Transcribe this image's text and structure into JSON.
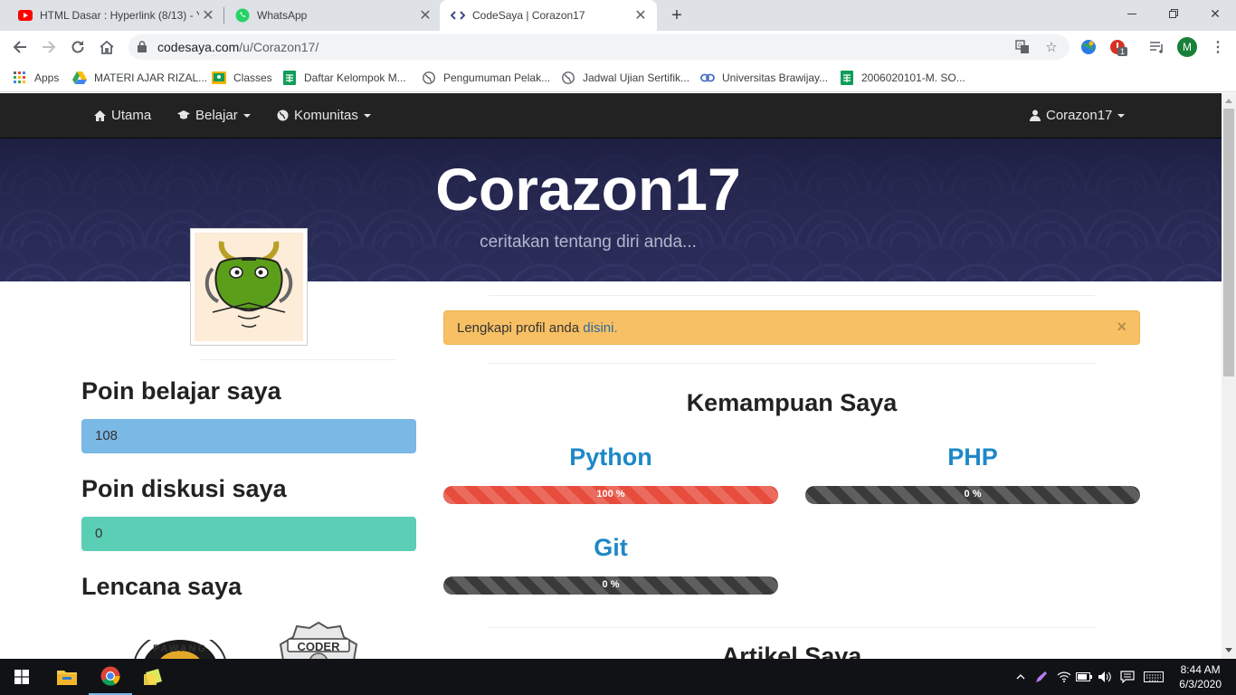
{
  "browser": {
    "tabs": [
      {
        "title": "HTML Dasar : Hyperlink (8/13) - Y",
        "icon": "youtube-icon",
        "active": false
      },
      {
        "title": "WhatsApp",
        "icon": "whatsapp-icon",
        "active": false
      },
      {
        "title": "CodeSaya | Corazon17",
        "icon": "codesaya-icon",
        "active": true
      }
    ],
    "url_host": "codesaya.com",
    "url_path": "/u/Corazon17/",
    "profile_initial": "M",
    "extension_badge": "1",
    "bookmarks": [
      {
        "label": "Apps",
        "icon": "apps-grid-icon"
      },
      {
        "label": "MATERI AJAR RIZAL...",
        "icon": "google-drive-icon"
      },
      {
        "label": "Classes",
        "icon": "google-classroom-icon"
      },
      {
        "label": "Daftar Kelompok M...",
        "icon": "google-sheets-icon"
      },
      {
        "label": "Pengumuman Pelak...",
        "icon": "globe-icon"
      },
      {
        "label": "Jadwal Ujian Sertifik...",
        "icon": "globe-icon"
      },
      {
        "label": "Universitas Brawijay...",
        "icon": "link-icon"
      },
      {
        "label": "2006020101-M. SO...",
        "icon": "google-sheets-icon"
      }
    ]
  },
  "site": {
    "nav": {
      "home": "Utama",
      "learn": "Belajar",
      "community": "Komunitas",
      "user": "Corazon17"
    },
    "hero": {
      "username": "Corazon17",
      "tagline": "ceritakan tentang diri anda..."
    },
    "sidebar": {
      "learning_points_title": "Poin belajar saya",
      "learning_points": "108",
      "discussion_points_title": "Poin diskusi saya",
      "discussion_points": "0",
      "badges_title": "Lencana saya",
      "badges": [
        {
          "name": "pawang-badge",
          "text": "PAWANG"
        },
        {
          "name": "coder-badge",
          "text": "CODER"
        }
      ]
    },
    "alert": {
      "text": "Lengkapi profil anda ",
      "link": "disini.",
      "close": "×"
    },
    "skills": {
      "title": "Kemampuan Saya",
      "items": [
        {
          "name": "Python",
          "percent": 100,
          "label": "100 %"
        },
        {
          "name": "PHP",
          "percent": 0,
          "label": "0 %"
        },
        {
          "name": "Git",
          "percent": 0,
          "label": "0 %"
        }
      ]
    },
    "articles_title": "Artikel Saya"
  },
  "colors": {
    "navbar": "#222222",
    "hero": "#2b2d5a",
    "learning_points_bg": "#7ab8e6",
    "discussion_points_bg": "#5bcfb5",
    "alert_bg": "#f8c064",
    "skill_title": "#1e88c7",
    "bar_full": "#e74c3c",
    "bar_empty": "#3a3a3a"
  },
  "taskbar": {
    "time": "8:44 AM",
    "date": "6/3/2020"
  }
}
